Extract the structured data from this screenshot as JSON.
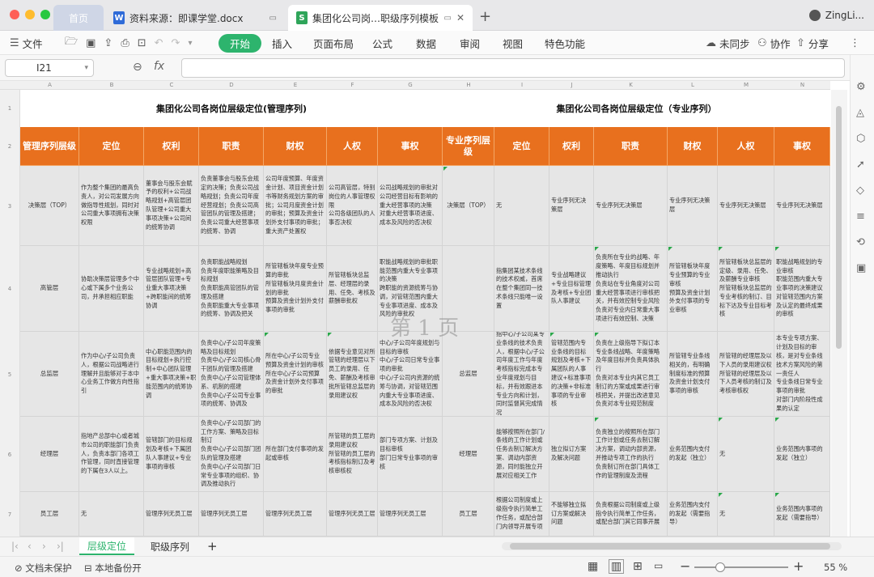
{
  "tabs": {
    "home": "首页",
    "doc": "资料来源：即课学堂.docx",
    "doc_icon": "W",
    "active": "集团化公司岗…职级序列模板",
    "active_icon": "S",
    "user": "ZingLi..."
  },
  "ribbon": {
    "file": "文件",
    "start": "开始",
    "items": [
      "插入",
      "页面布局",
      "公式",
      "数据",
      "审阅",
      "视图",
      "特色功能"
    ],
    "sync": "未同步",
    "collab": "协作",
    "share": "分享"
  },
  "formula": {
    "cell_ref": "I21",
    "fx": "fx",
    "value": ""
  },
  "columns": [
    "A",
    "B",
    "C",
    "D",
    "E",
    "F",
    "G",
    "H",
    "I",
    "J",
    "K",
    "L",
    "M",
    "N"
  ],
  "rows": [
    "1",
    "2",
    "3",
    "4",
    "5",
    "6",
    "7"
  ],
  "titles": {
    "left": "集团化公司各岗位层级定位(管理序列)",
    "right": "集团化公司各岗位层级定位（专业序列）"
  },
  "headers": [
    "管理序列层级",
    "定位",
    "权利",
    "职责",
    "财权",
    "人权",
    "事权",
    "专业序列层级",
    "定位",
    "权利",
    "职责",
    "财权",
    "人权",
    "事权"
  ],
  "table": [
    [
      "决策层（TOP）",
      "作为整个集团的最高负责人，对公司发展方向做指导性规划，同时对公司重大事项拥有决策权限",
      "董事会与股东会赋予的权利+公司战略规划+高管层团队管理+公司重大事项决策+公司间的统筹协调",
      "负责董事会与股东会规定的决策；负责公司战略规划；负责公司年度经营规划；负责公司高管团队的管理及搭建；负责公司重大经营事项的统筹、协调",
      "公司年度预算、年度资金计划、项目资金计划书等财务规划方案的审批；公司月度资金计划的审批；预算及资金计划外支付事项的审批；重大资产处置权",
      "公司高管层，特别岗位的人事管理权限\n公司各级团队的人事否决权",
      "公司战略规划的审批对公司经营目标有影响的重大经营事项的决策\n对重大经营事项进度、成本及风险的否决权",
      "决策层（TOP）",
      "无",
      "专业序列无决策层",
      "专业序列无决策层",
      "专业序列无决策层",
      "专业序列无决策层",
      "专业序列无决策层"
    ],
    [
      "高管层",
      "协助决策层管理多个中心或下属多个业务公司，并承担相应职能",
      "专业战略规划+高管层团队管理+专业重大事项决策+跨职能间的统筹协调",
      "负责职能战略规划\n负责年度职能策略及目标规划\n负责职能高管团队的管理及搭建\n负责职能重大专业事项的统筹、协调及把关",
      "所管辖板块年度专业预算的审批\n所管辖板块月度资金计划的审批\n预算及资金计划外支付事项的审批",
      "所管辖板块总监层、经理层的录用、任免、考核及薪酬审批权",
      "职能战略规划的审批职能范围内重大专业事项的决策\n跨职能的资源统筹与协调，对管辖范围内重大专业事项进度、成本及风险的审批权",
      "",
      "指集团某技术条线的技术权威，首席在整个集团同一技术条线只能唯一设置",
      "专业战略建议+专业目标管理及考核+专业团队人事建议",
      "负责所在专业的战略、年度策略、年度目标规划并推动执行\n负责站在专业角度对公司重大经营事项进行审核把关，并有效控制专业风险\n负责对专业内日常重大事项进行有效控制、决策",
      "所管辖板块年度专业预算的专业审核\n预算及资金计划外支付事项的专业审核",
      "所管辖板块总监层的定级、录用、任免、及薪酬专业审核\n所管辖板块总监层的专业考核的制订、目标下达及专业目标考核",
      "职能战略规划的专业审核\n职能范围内重大专业事项的决策建议\n对管辖范围内方案及认定的最终成果的审核"
    ],
    [
      "总监层",
      "作为中心/子公司负责人，根据公司战略进行理解并且能够对于本中心业务工作做方向性指引",
      "中心职能范围内的目标规划+执行控制+中心团队管理+重大事项决策+职能范围内的统筹协调",
      "负责中心/子公司年度策略及目标规划\n负责中心/子公司核心骨干团队的管理及搭建\n负责中心/子公司管理体系、机制的搭建\n负责中心/子公司专业事项的统筹、协调及",
      "所在中心/子公司专业预算及资金计划的审核\n所在中心/子公司预算及资金计划外支付事项的审批",
      "依据专业意见对所管辖的经理层以下员工的录用、任免、薪酬及考核审批所管辖总监层的录用建议权",
      "中心/子公司年度规划与目标的审核\n中心/子公司日常专业事项的审批\n中心/子公司内资源的统筹与协调，对管辖范围内重大专业事项进度、成本及风险的否决权",
      "总监层",
      "指中心/子公司某专业条线的技术负责人，根据中心/子公司年度工作与年度考核指标完成本专业年度规划与目标，并有效跟进本专业方向和计划，同时监督其完成情况",
      "管辖范围内专业条线的目标规划及考核+下属团队的人事建议+标准事项的决策+非标准事项的专业审核",
      "负责在上级指导下拟订本专业条线战略、年度策略及年度目标并负责具体执行\n负责对本专业内其它员工制订的方案或成果进行审核把关，并提出改进意见\n负责对本专业规范制度",
      "所管辖专业条线相关的，有明确制度标准的预算及资金计划支付事项的审核",
      "所管辖的经理层及以下人员的录用建议权\n所管辖的经理层及以下人员考核的制订及考核审核权",
      "本专业专项方案、计划及目标的审核，是对专业条线技术方案风险的第一责任人\n专业条线日常专业事项的审批\n对部门内阶段性成果的认定"
    ],
    [
      "经理层",
      "指地产总部中心或者城市公司的职能部门负责人，负责本部门各项工作管理，同时直接管理的下属在3人以上。",
      "管辖部门的目标规划及考核+下属团队人事建议+专业事项的审核",
      "负责中心/子公司部门的工作方案、策略及目标制订\n负责中心/子公司部门团队的管理及搭建\n负责中心/子公司部门日常专业事项的组织、协调及推动执行",
      "所在部门支付事项的发起或审核",
      "所管辖的员工层的录用建议权\n所管辖的员工层的考核指标制订及考核审核权",
      "部门专项方案、计划及目标审核\n部门日常专业事项的审核",
      "经理层",
      "能够按照所在部门/条线的工作计划或任务去制订解决方案、调动内部资源，同时能独立开展对应相关工作",
      "独立拟订方案及解决问题",
      "负责独立的按照所在部门工作计划或任务去制订解决方案，调动内部资源，并推动专项工作的执行\n负责制订所在部门具体工作的管理制度及流程",
      "业务范围内支付的发起（独立）",
      "无",
      "业务范围内事项的发起（独立）"
    ],
    [
      "员工层",
      "无",
      "管理序列无员工层",
      "管理序列无员工层",
      "管理序列无员工层",
      "管理序列无员工层",
      "管理序列无员工层",
      "员工层",
      "根据公司制度或上级指令执行简单工作任务，或配合部门内领导开展专项",
      "不能够独立拟订方案或解决问题",
      "负责根据公司制度或上级指令执行简单工作任务，或配合部门其它同事开展",
      "业务范围内支付的发起（需要指导）",
      "无",
      "业务范围内事项的发起（需要指导）"
    ]
  ],
  "watermark": "第 1 页",
  "sheets": [
    "层级定位",
    "职级序列"
  ],
  "status": {
    "protect": "文档未保护",
    "backup": "本地备份开",
    "zoom": "55 %"
  },
  "colors": {
    "accent": "#2db46d",
    "header_orange": "#e8701e"
  }
}
